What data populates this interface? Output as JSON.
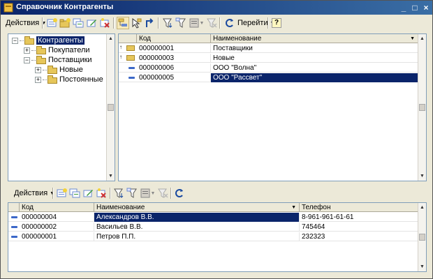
{
  "window": {
    "title": "Справочник Контрагенты",
    "controls": [
      "_",
      "□",
      "×"
    ]
  },
  "toolbar_top": {
    "actions_label": "Действия",
    "goto_label": "Перейти",
    "help_label": "?"
  },
  "tree": {
    "root": "Контрагенты",
    "items": [
      {
        "label": "Покупатели",
        "pm": "+"
      },
      {
        "label": "Поставщики",
        "pm": "−"
      },
      {
        "label": "Новые",
        "pm": "+"
      },
      {
        "label": "Постоянные",
        "pm": "+"
      }
    ],
    "root_pm": "−"
  },
  "list_top": {
    "columns": [
      "Код",
      "Наименование"
    ],
    "rows": [
      {
        "code": "000000001",
        "name": "Поставщики",
        "kind": "folder",
        "up": "↑"
      },
      {
        "code": "000000003",
        "name": "Новые",
        "kind": "folder",
        "up": "↑"
      },
      {
        "code": "000000006",
        "name": "ООО \"Волна\"",
        "kind": "item"
      },
      {
        "code": "000000005",
        "name": "ООО \"Рассвет\"",
        "kind": "item",
        "selected": true
      }
    ]
  },
  "toolbar_bottom": {
    "actions_label": "Действия"
  },
  "list_bottom": {
    "columns": [
      "Код",
      "Наименование",
      "Телефон"
    ],
    "rows": [
      {
        "code": "000000004",
        "name": "Александров В.В.",
        "phone": "8-961-961-61-61",
        "selected": true
      },
      {
        "code": "000000002",
        "name": "Васильев В.В.",
        "phone": "745464"
      },
      {
        "code": "000000001",
        "name": "Петров П.П.",
        "phone": "232323"
      }
    ]
  },
  "colors": {
    "titlebar": "#0a246a",
    "selection": "#0a246a",
    "face": "#ece9d8"
  }
}
